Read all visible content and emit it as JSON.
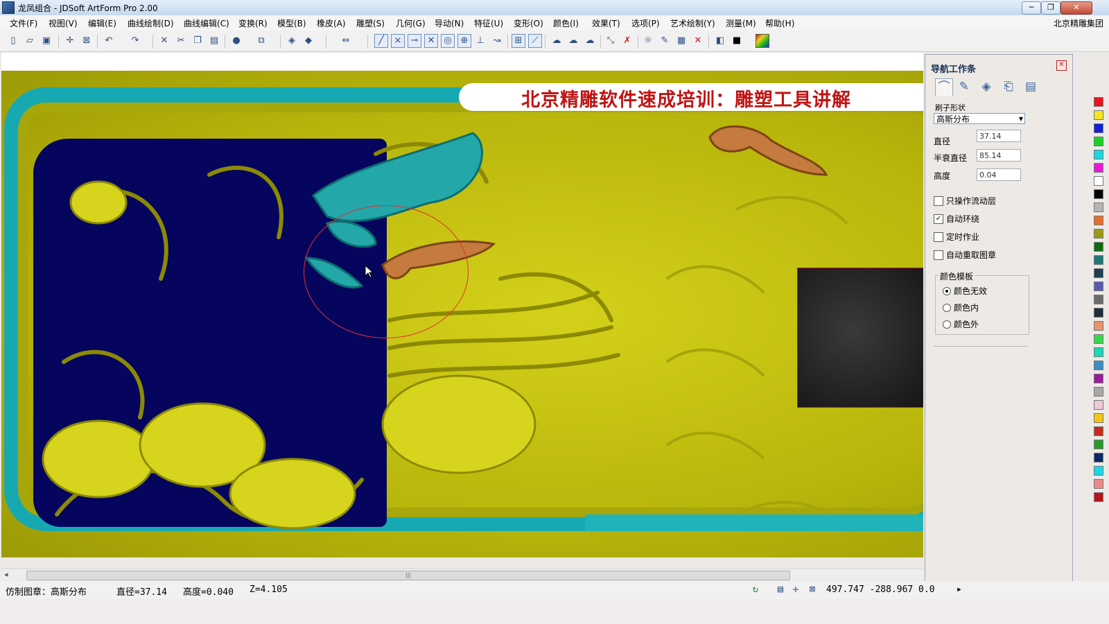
{
  "window": {
    "title": "龙凤组合 - JDSoft ArtForm Pro 2.00",
    "buttons": [
      "─",
      "❐",
      "✕"
    ]
  },
  "menubar": {
    "items": [
      "文件(F)",
      "视图(V)",
      "编辑(E)",
      "曲线绘制(D)",
      "曲线编辑(C)",
      "变换(R)",
      "模型(B)",
      "橡皮(A)",
      "雕塑(S)",
      "几何(G)",
      "导动(N)",
      "特征(U)",
      "变形(O)",
      "颜色(I)",
      "效果(T)",
      "选项(P)",
      "艺术绘制(Y)",
      "测量(M)",
      "帮助(H)"
    ],
    "right_label": "北京精雕集团"
  },
  "toolbar": {
    "icons": [
      "new-file-icon",
      "open-file-icon",
      "save-icon",
      "pan-icon",
      "zoom-window-icon",
      "undo-icon",
      "redo-icon",
      "cut-icon",
      "scissors-icon",
      "copy-icon",
      "paste-icon",
      "sphere-icon",
      "box-view-icon",
      "shade-icon",
      "shade-dark-icon",
      "arrows-icon",
      "line-icon",
      "trim-icon",
      "extend-icon",
      "cross-icon",
      "circle-snap-icon",
      "center-snap-icon",
      "perpendicular-icon",
      "tangent-icon",
      "grid-icon",
      "measure-icon",
      "sculpt-a-icon",
      "sculpt-b-icon",
      "sculpt-c-icon",
      "point-edit-icon",
      "point-delete-icon",
      "light-icon",
      "brush-icon",
      "layer-icon",
      "delete-icon",
      "model-icon",
      "color-black-icon",
      "gradient-icon"
    ]
  },
  "viewport": {
    "banner": "北京精雕软件速成培训：雕塑工具讲解"
  },
  "panel": {
    "title": "导航工作条",
    "tab_icons": [
      "sculpt-tool-icon",
      "paint-tool-icon",
      "eraser-tool-icon",
      "stamp-tool-icon",
      "list-tool-icon"
    ],
    "section_label": "刷子形状",
    "brush_shape": "高斯分布",
    "fields": [
      {
        "label": "直径",
        "value": "37.14"
      },
      {
        "label": "半衰直径",
        "value": "85.14"
      },
      {
        "label": "高度",
        "value": "0.04"
      }
    ],
    "checkboxes": [
      {
        "label": "只操作流动层",
        "checked": false
      },
      {
        "label": "自动环绕",
        "checked": true
      },
      {
        "label": "定时作业",
        "checked": false
      },
      {
        "label": "自动重取图章",
        "checked": false
      }
    ],
    "color_group": {
      "label": "颜色模板",
      "options": [
        {
          "label": "颜色无效",
          "selected": true
        },
        {
          "label": "颜色内",
          "selected": false
        },
        {
          "label": "颜色外",
          "selected": false
        }
      ]
    }
  },
  "palette": [
    "#e8141b",
    "#f5e51a",
    "#1320d6",
    "#18d21f",
    "#1ad8e0",
    "#e81ad8",
    "#ffffff",
    "#000000",
    "#b5b5b5",
    "#e86c2c",
    "#9b9b12",
    "#0f6b10",
    "#1e7a7a",
    "#203f55",
    "#5a5ab3",
    "#6c6c6c",
    "#202c3a",
    "#e8946c",
    "#38d84b",
    "#1ad8b8",
    "#3b8ec8",
    "#9b1a9b",
    "#a8a8a8",
    "#f0c8d8",
    "#f5c518",
    "#c42b1a",
    "#2a9b2a",
    "#0c2a6a",
    "#1ad8e8",
    "#f08888",
    "#b8141b"
  ],
  "status": {
    "tool": "仿制图章：高斯分布",
    "diameter": "直径=37.14",
    "height": "高度=0.040",
    "z": "Z=4.105",
    "coords": "497.747  -288.967  0.0"
  }
}
